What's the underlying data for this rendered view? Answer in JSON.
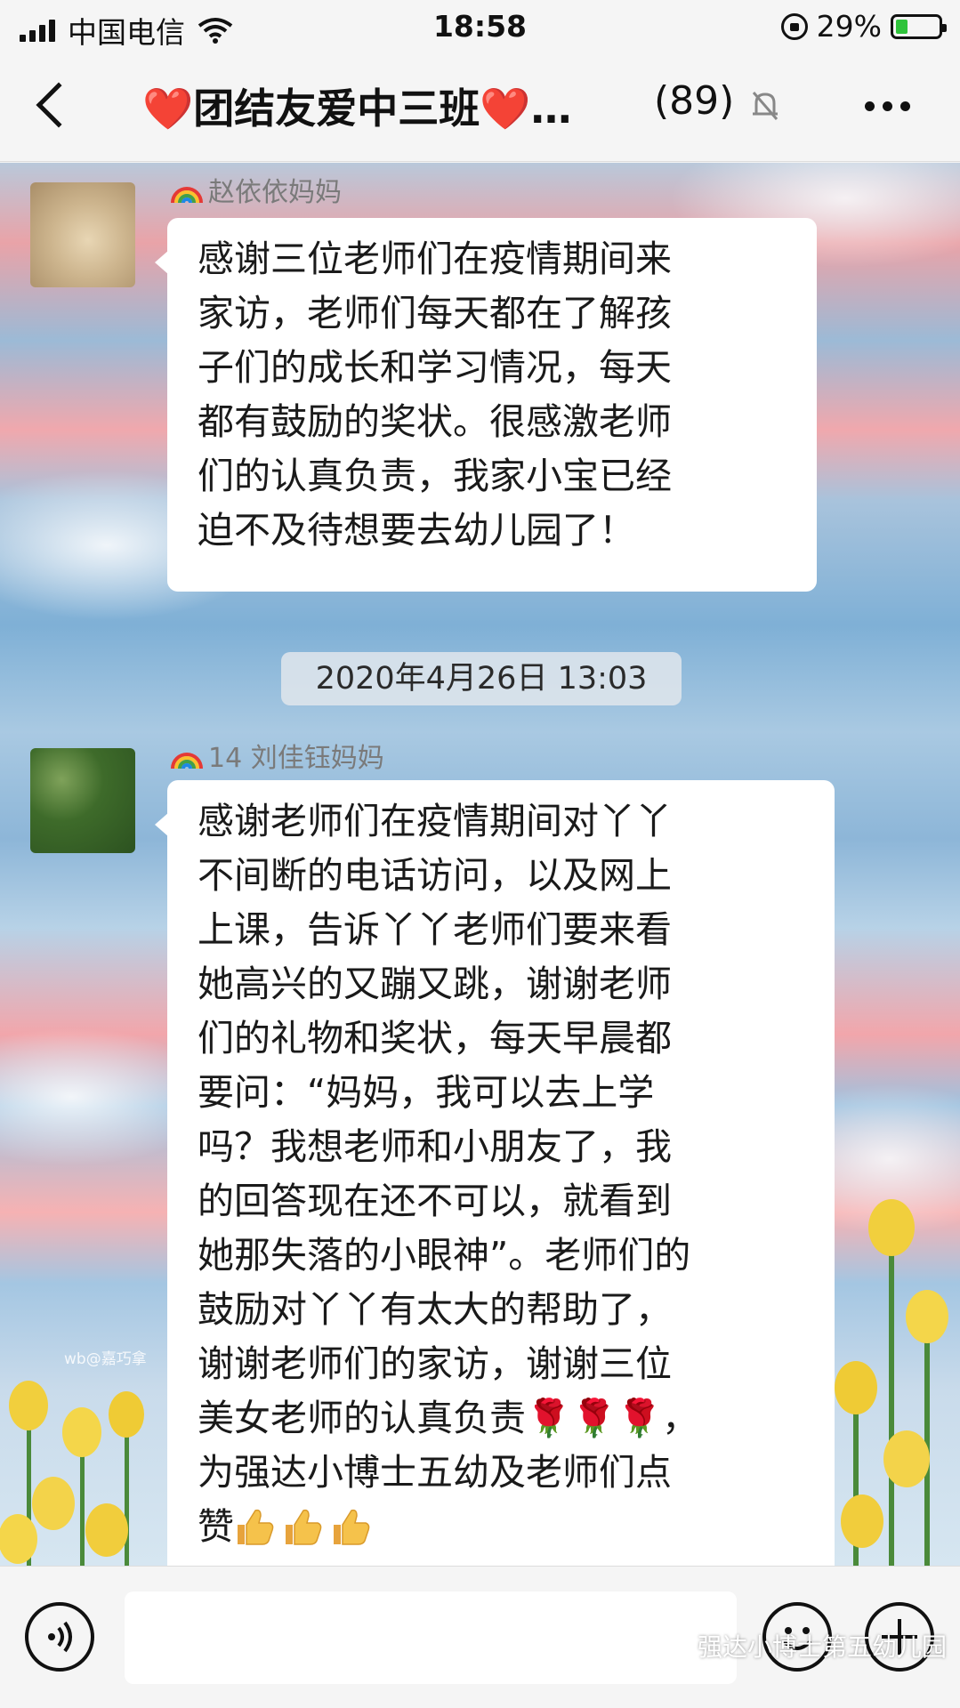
{
  "status_bar": {
    "carrier": "中国电信",
    "time": "18:58",
    "battery": "29%",
    "battery_level": 0.29,
    "icons": [
      "signal-icon",
      "wifi-icon",
      "rotation-lock-icon",
      "battery-charging-icon"
    ]
  },
  "header": {
    "back_icon": "chevron-left-icon",
    "title": "❤️团结友爱中三班❤️…",
    "member_count": "(89)",
    "mute_icon": "bell-muted-icon",
    "more_icon": "more-dots-icon"
  },
  "messages": [
    {
      "sender": "赵依依妈妈",
      "sender_prefix_icon": "rainbow-icon",
      "lines": [
        " 感谢三位老师们在疫情期间来",
        "家访，老师们每天都在了解孩",
        "子们的成长和学习情况，每天",
        "都有鼓励的奖状。很感激老师",
        "们的认真负责，我家小宝已经",
        "迫不及待想要去幼儿园了！"
      ]
    },
    {
      "sender": "14 刘佳钰妈妈",
      "sender_prefix_icon": "rainbow-icon",
      "lines": [
        "感谢老师们在疫情期间对丫丫",
        "不间断的电话访问，以及网上",
        "上课，告诉丫丫老师们要来看",
        "她高兴的又蹦又跳，谢谢老师",
        "们的礼物和奖状，每天早晨都",
        "要问：“妈妈，我可以去上学",
        "吗？我想老师和小朋友了，我",
        "的回答现在还不可以，就看到",
        "她那失落的小眼神”。老师们的",
        "鼓励对丫丫有太大的帮助了，",
        "谢谢老师们的家访，谢谢三位",
        "美女老师的认真负责🌹🌹🌹，",
        "为强达小博士五幼及老师们点",
        "赞"
      ],
      "trailing_icons": [
        "thumbs-up-icon",
        "thumbs-up-icon",
        "thumbs-up-icon"
      ]
    }
  ],
  "timestamp": "2020年4月26日 13:03",
  "background_signature": "wb@嘉巧拿",
  "input_bar": {
    "voice_icon": "voice-icon",
    "input_value": "",
    "emoji_icon": "emoji-icon",
    "add_icon": "plus-icon"
  },
  "watermark": "强达小博士第五幼儿园",
  "colors": {
    "bubble": "#ffffff",
    "heart": "#e0242a",
    "battery_fill": "#2fc33b"
  }
}
